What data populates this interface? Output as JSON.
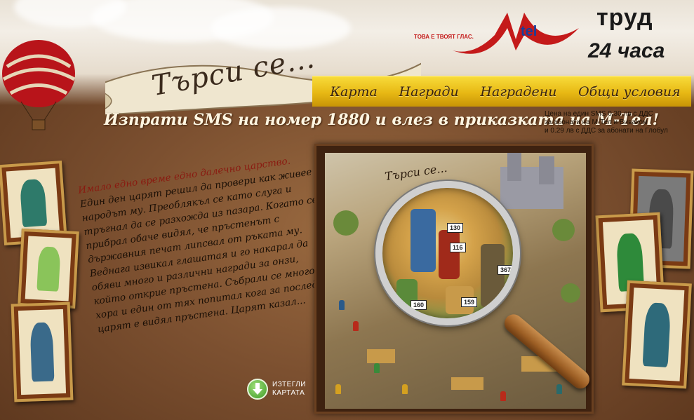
{
  "header": {
    "banner_title": "Търси се...",
    "mtel_slogan": "ТОВА Е ТВОЯТ ГЛАС.",
    "mtel_logo_text": "tel",
    "partner_name": "труд",
    "partner_name_2": "24 часа"
  },
  "nav": {
    "items": [
      {
        "label": "Карта"
      },
      {
        "label": "Награди"
      },
      {
        "label": "Наградени"
      },
      {
        "label": "Общи условия"
      }
    ]
  },
  "headline": "Изпрати SMS на номер 1880 и влез в приказката на М-Тел!",
  "price_info": {
    "line1": "Цена на един SMS 0.30 лв с ДДС",
    "line2": "за абонати на М-Тел и Виваком",
    "line3": "и 0.29 лв с ДДС за абонати на Глобул"
  },
  "story": {
    "first_line": "Имало едно време едно далечно царство.",
    "body": "Един ден царят решил да провери как живее народът му. Преоблякъл се като слуга и тръгнал да се разхожда из пазара. Когато се прибрал обаче видял, че пръстенът с държавния печат липсвал от ръката му. Веднага извикал глашатая и го накарал да обяви много и различни награди за онзи, който открие пръстена. Събрали се много хора и един от тях попитал кога за последно царят е видял пръстена. Царят казал..."
  },
  "download": {
    "line1": "ИЗТЕГЛИ",
    "line2": "КАРТАТА",
    "icon": "download-arrow-icon"
  },
  "map": {
    "title": "Търси се...",
    "tags": [
      "130",
      "116",
      "367",
      "160",
      "159"
    ]
  },
  "colors": {
    "nav_yellow": "#e7b814",
    "brand_red": "#c41a1a",
    "brand_blue": "#1a3e9a",
    "background_brown": "#7c5030"
  }
}
